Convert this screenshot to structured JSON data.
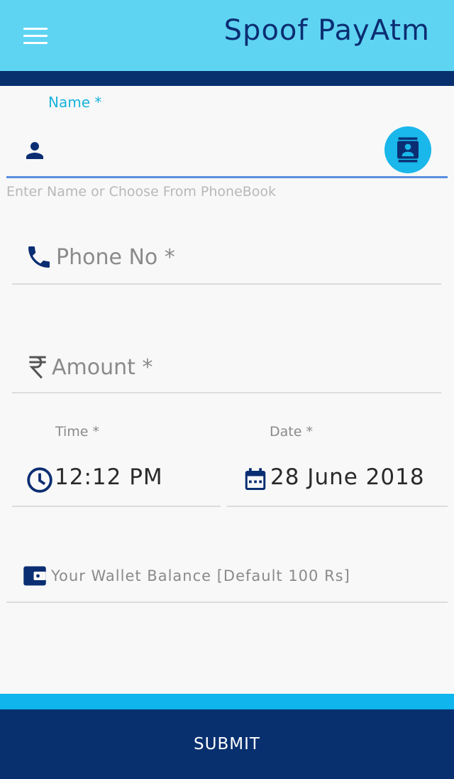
{
  "header": {
    "app_title": "Spoof PayAtm",
    "menu_icon": "hamburger-menu-icon",
    "bg_color": "#5fd4f2",
    "title_color": "#0b2e72"
  },
  "form": {
    "name": {
      "label": "Name *",
      "value": "",
      "helper": "Enter Name or Choose From PhoneBook",
      "leading_icon": "person-icon",
      "action_icon": "contacts-book-icon"
    },
    "phone": {
      "placeholder": "Phone No *",
      "icon": "phone-icon"
    },
    "amount": {
      "placeholder": "Amount *",
      "icon": "rupee-icon"
    },
    "time": {
      "label": "Time *",
      "value": "12:12 PM",
      "icon": "clock-icon"
    },
    "date": {
      "label": "Date *",
      "value": "28 June 2018",
      "icon": "calendar-icon"
    },
    "wallet": {
      "placeholder": "Your Wallet Balance [Default 100 Rs]",
      "icon": "wallet-icon"
    }
  },
  "footer": {
    "submit_label": "SUBMIT",
    "bg_color": "#08306f",
    "accent_color": "#0fb5ec"
  }
}
